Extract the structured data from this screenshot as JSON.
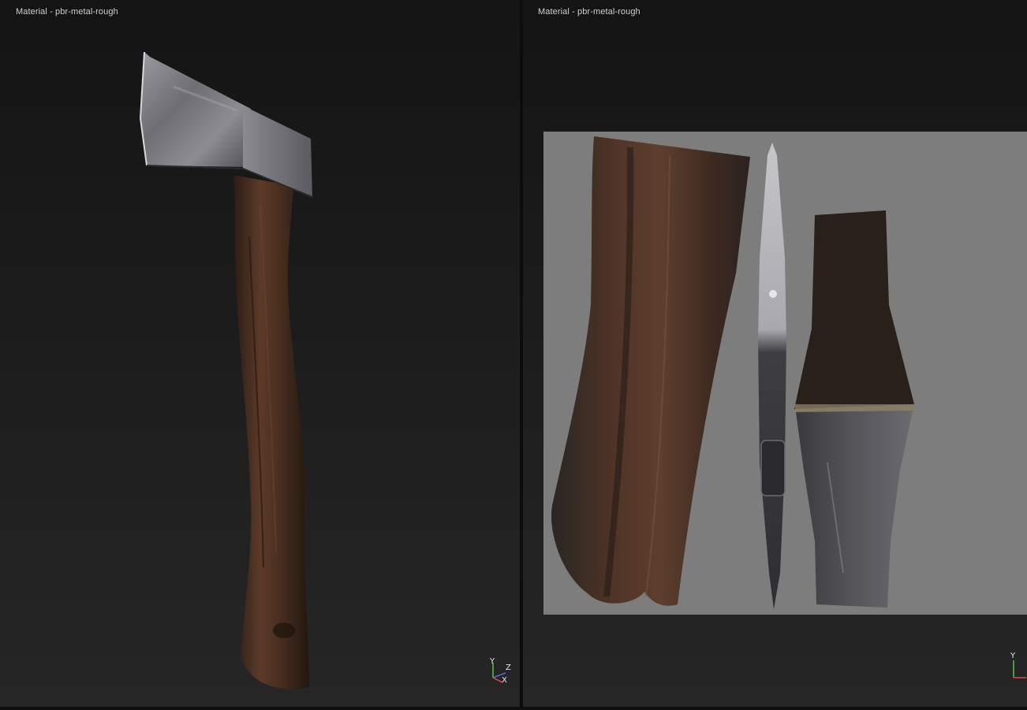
{
  "viewports": [
    {
      "id": "3d-view",
      "label": "Material - pbr-metal-rough",
      "gizmo": {
        "axes": [
          "Y",
          "Z",
          "X"
        ]
      }
    },
    {
      "id": "uv-view",
      "label": "Material - pbr-metal-rough",
      "gizmo": {
        "axes": [
          "Y"
        ]
      }
    }
  ],
  "colors": {
    "background": "#1a1a1a",
    "uv_background": "#7d7d7d",
    "wood_dark": "#2a1d15",
    "wood_mid": "#5a3a28",
    "metal_light": "#b8b8bc",
    "metal_dark": "#4a4a4e",
    "axis_x": "#d94a4a",
    "axis_y": "#5ac05a",
    "axis_z": "#5a6ad9"
  },
  "icons": [
    "axis-gizmo-icon"
  ]
}
